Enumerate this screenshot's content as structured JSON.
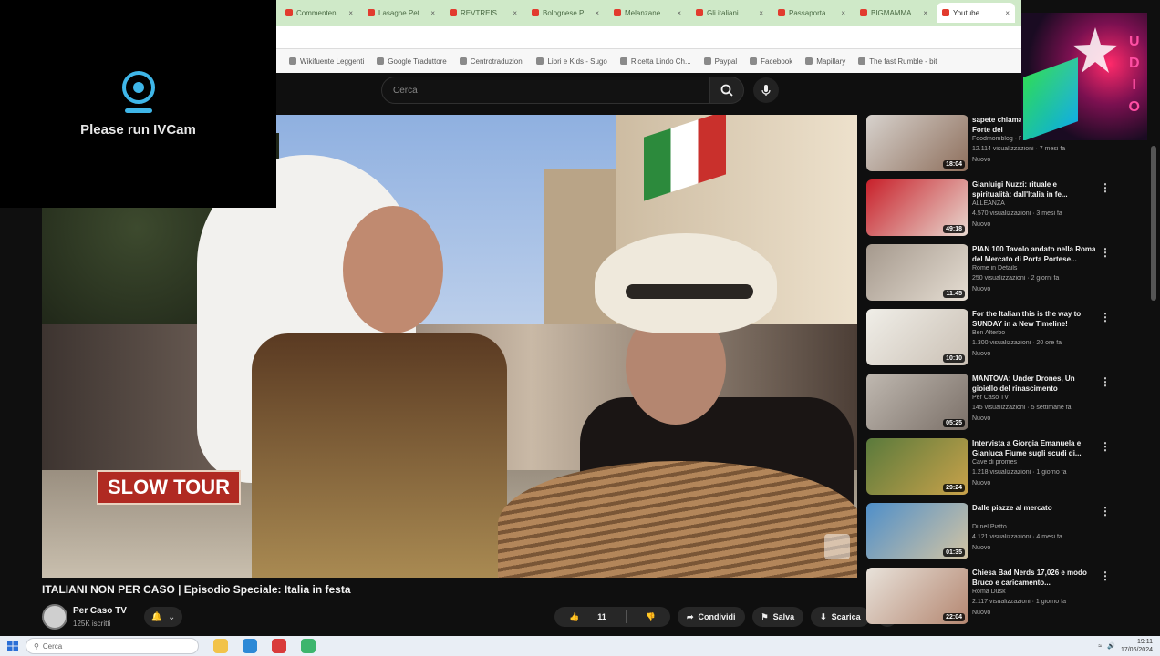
{
  "ivcam": {
    "message": "Please run IVCam",
    "icon": "webcam-icon"
  },
  "browser": {
    "tabs": [
      {
        "label": "Commenten",
        "active": false
      },
      {
        "label": "Lasagne Pet",
        "active": false
      },
      {
        "label": "REVTREIS",
        "active": false
      },
      {
        "label": "Bolognese P",
        "active": false
      },
      {
        "label": "Melanzane",
        "active": false
      },
      {
        "label": "Gli italiani",
        "active": false
      },
      {
        "label": "Passaporta",
        "active": false
      },
      {
        "label": "BIGMAMMA",
        "active": false
      },
      {
        "label": "Youtube",
        "active": true
      }
    ],
    "bookmarks": [
      "Wikifuente Leggenti",
      "Google Traduttore",
      "Centrotraduzioni",
      "Libri e Kids - Sugo",
      "Ricetta Lindo Ch...",
      "Paypal",
      "Facebook",
      "Mapillary",
      "The fast Rumble - bit"
    ]
  },
  "studio_logo": {
    "letters": [
      "U",
      "D",
      "I",
      "O"
    ]
  },
  "youtube": {
    "search_placeholder": "Cerca",
    "video": {
      "overlay_text": "SLOW TOUR",
      "title": "ITALIANI NON PER CASO | Episodio Speciale: Italia in festa",
      "channel": "Per Caso TV",
      "subscribers": "125K iscritti",
      "likes": "11",
      "actions": {
        "share": "Condividi",
        "save": "Salva",
        "download": "Scarica"
      }
    },
    "recommendations": [
      {
        "title": "sapete chiamare la Rosa di Bari Forte dei",
        "channel": "Foodmomblog - Foodie",
        "meta": "12.114 visualizzazioni · 7 mesi fa",
        "badge": "Nuovo",
        "duration": "18:04",
        "colors": [
          "#d7d2cd",
          "#8e6f5c"
        ]
      },
      {
        "title": "Gianluigi Nuzzi: rituale e spiritualità: dall'Italia in fe...",
        "channel": "ALLEANZA",
        "meta": "4.570 visualizzazioni · 3 mesi fa",
        "badge": "Nuovo",
        "duration": "49:18",
        "colors": [
          "#c8202a",
          "#e8d9d0"
        ]
      },
      {
        "title": "PIAN 100 Tavolo andato nella Roma del Mercato di Porta Portese...",
        "channel": "Rome in Details",
        "meta": "250 visualizzazioni · 2 giorni fa",
        "badge": "Nuovo",
        "duration": "11:45",
        "colors": [
          "#a5998d",
          "#e5ddd2"
        ]
      },
      {
        "title": "For the Italian this is the way to SUNDAY in a New Timeline!",
        "channel": "Ben Alterbo",
        "meta": "1.300 visualizzazioni · 20 ore fa",
        "badge": "Nuovo",
        "duration": "10:10",
        "colors": [
          "#f0eee8",
          "#cac0b4"
        ]
      },
      {
        "title": "MANTOVA: Under Drones, Un gioiello del rinascimento",
        "channel": "Per Caso TV",
        "meta": "145 visualizzazioni · 5 settimane fa",
        "badge": "Nuovo",
        "duration": "05:25",
        "colors": [
          "#bfb8b0",
          "#7b7068"
        ]
      },
      {
        "title": "Intervista a Giorgia Emanuela e Gianluca Fiume sugli scudi di...",
        "channel": "Cave di promes",
        "meta": "1.218 visualizzazioni · 1 giorno fa",
        "badge": "Nuovo",
        "duration": "29:24",
        "colors": [
          "#5a7a3c",
          "#c9a24a"
        ]
      },
      {
        "title": "Dalle piazze al mercato",
        "channel": "Di nel Piatto",
        "meta": "4.121 visualizzazioni · 4 mesi fa",
        "badge": "Nuovo",
        "duration": "01:35",
        "colors": [
          "#4f8fc9",
          "#d3c4a3"
        ]
      },
      {
        "title": "Chiesa Bad Nerds 17,026 e modo Bruco e caricamento...",
        "channel": "Roma Dusk",
        "meta": "2.117 visualizzazioni · 1 giorno fa",
        "badge": "Nuovo",
        "duration": "22:04",
        "colors": [
          "#e8e2da",
          "#b48670"
        ]
      }
    ]
  },
  "taskbar": {
    "search_placeholder": "Cerca",
    "time": "19:11",
    "date": "17/06/2024"
  }
}
